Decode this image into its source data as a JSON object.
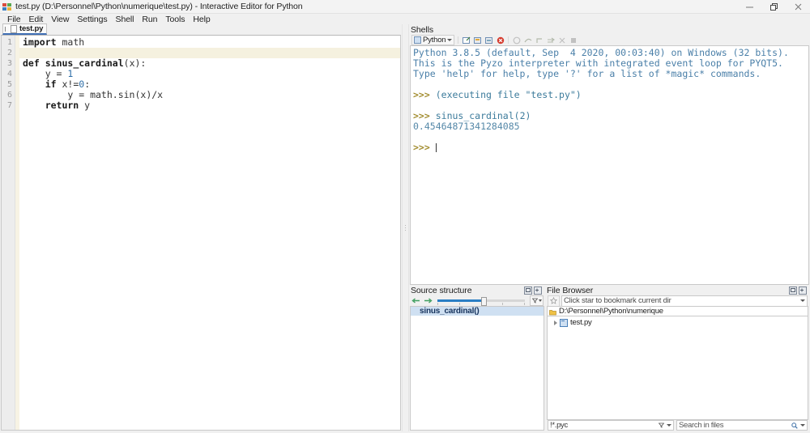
{
  "window": {
    "title": "test.py (D:\\Personnel\\Python\\numerique\\test.py) - Interactive Editor for Python",
    "app_icon": "pyzo-logo-icon",
    "minimize_icon": "minimize-icon",
    "restore_icon": "restore-icon",
    "close_icon": "close-icon"
  },
  "menubar": {
    "items": [
      {
        "label": "File"
      },
      {
        "label": "Edit"
      },
      {
        "label": "View"
      },
      {
        "label": "Settings"
      },
      {
        "label": "Shell"
      },
      {
        "label": "Run"
      },
      {
        "label": "Tools"
      },
      {
        "label": "Help"
      }
    ]
  },
  "editor": {
    "tab": {
      "label": "test.py",
      "icon": "document-icon"
    },
    "line_numbers": [
      "1",
      "2",
      "3",
      "4",
      "5",
      "6",
      "7"
    ],
    "current_line": 2,
    "lines": [
      {
        "n": "1",
        "text": "import math"
      },
      {
        "n": "2",
        "text": ""
      },
      {
        "n": "3",
        "text": "def sinus_cardinal(x):"
      },
      {
        "n": "4",
        "text": "    y = 1"
      },
      {
        "n": "5",
        "text": "    if x!=0:"
      },
      {
        "n": "6",
        "text": "        y = math.sin(x)/x"
      },
      {
        "n": "7",
        "text": "    return y"
      }
    ]
  },
  "shells": {
    "panel_title": "Shells",
    "selector_label": "Python",
    "toolbar": [
      {
        "name": "new-shell-icon"
      },
      {
        "name": "edit-shell-config-icon"
      },
      {
        "name": "restart-shell-icon"
      },
      {
        "name": "terminate-shell-icon"
      },
      {
        "name": "interrupt-icon"
      },
      {
        "name": "debug-next-icon"
      },
      {
        "name": "debug-step-icon"
      },
      {
        "name": "debug-return-icon"
      },
      {
        "name": "debug-stop-icon"
      },
      {
        "name": "stop-icon"
      }
    ],
    "output": [
      {
        "type": "banner",
        "text": "Python 3.8.5 (default, Sep  4 2020, 00:03:40) on Windows (32 bits)."
      },
      {
        "type": "banner",
        "text": "This is the Pyzo interpreter with integrated event loop for PYQT5."
      },
      {
        "type": "banner",
        "text": "Type 'help' for help, type '?' for a list of *magic* commands."
      },
      {
        "type": "blank",
        "text": ""
      },
      {
        "type": "prompt-note",
        "prompt": ">>>",
        "text": "(executing file \"test.py\")"
      },
      {
        "type": "blank",
        "text": ""
      },
      {
        "type": "prompt-input",
        "prompt": ">>>",
        "text": "sinus_cardinal(2)"
      },
      {
        "type": "result",
        "text": "0.45464871341284085"
      },
      {
        "type": "blank",
        "text": ""
      },
      {
        "type": "prompt-cursor",
        "prompt": ">>>",
        "text": ""
      }
    ]
  },
  "source_structure": {
    "panel_title": "Source structure",
    "back_icon": "arrow-left-icon",
    "forward_icon": "arrow-right-icon",
    "filter_icon": "filter-icon",
    "items": [
      {
        "label": "sinus_cardinal()"
      }
    ]
  },
  "file_browser": {
    "panel_title": "File Browser",
    "star_icon": "star-icon",
    "bookmark_placeholder": "Click star to bookmark current dir",
    "current_path": "D:\\Personnel\\Python\\numerique",
    "path_icon": "folder-icon",
    "tree": [
      {
        "label": "test.py",
        "icon": "file-icon",
        "expander": "chevron-right-icon"
      }
    ],
    "file_filter": "!*.pyc",
    "search_placeholder": "Search in files",
    "search_icon": "magnifier-icon",
    "filter_icon": "filter-icon"
  },
  "colors": {
    "accent_blue": "#2a7ec4",
    "tab_underline": "#3f6fb5",
    "prompt_gold": "#a08a2a",
    "shell_text": "#4a7fa8",
    "selection": "#cfe0f2",
    "current_line": "#f5f1df"
  }
}
